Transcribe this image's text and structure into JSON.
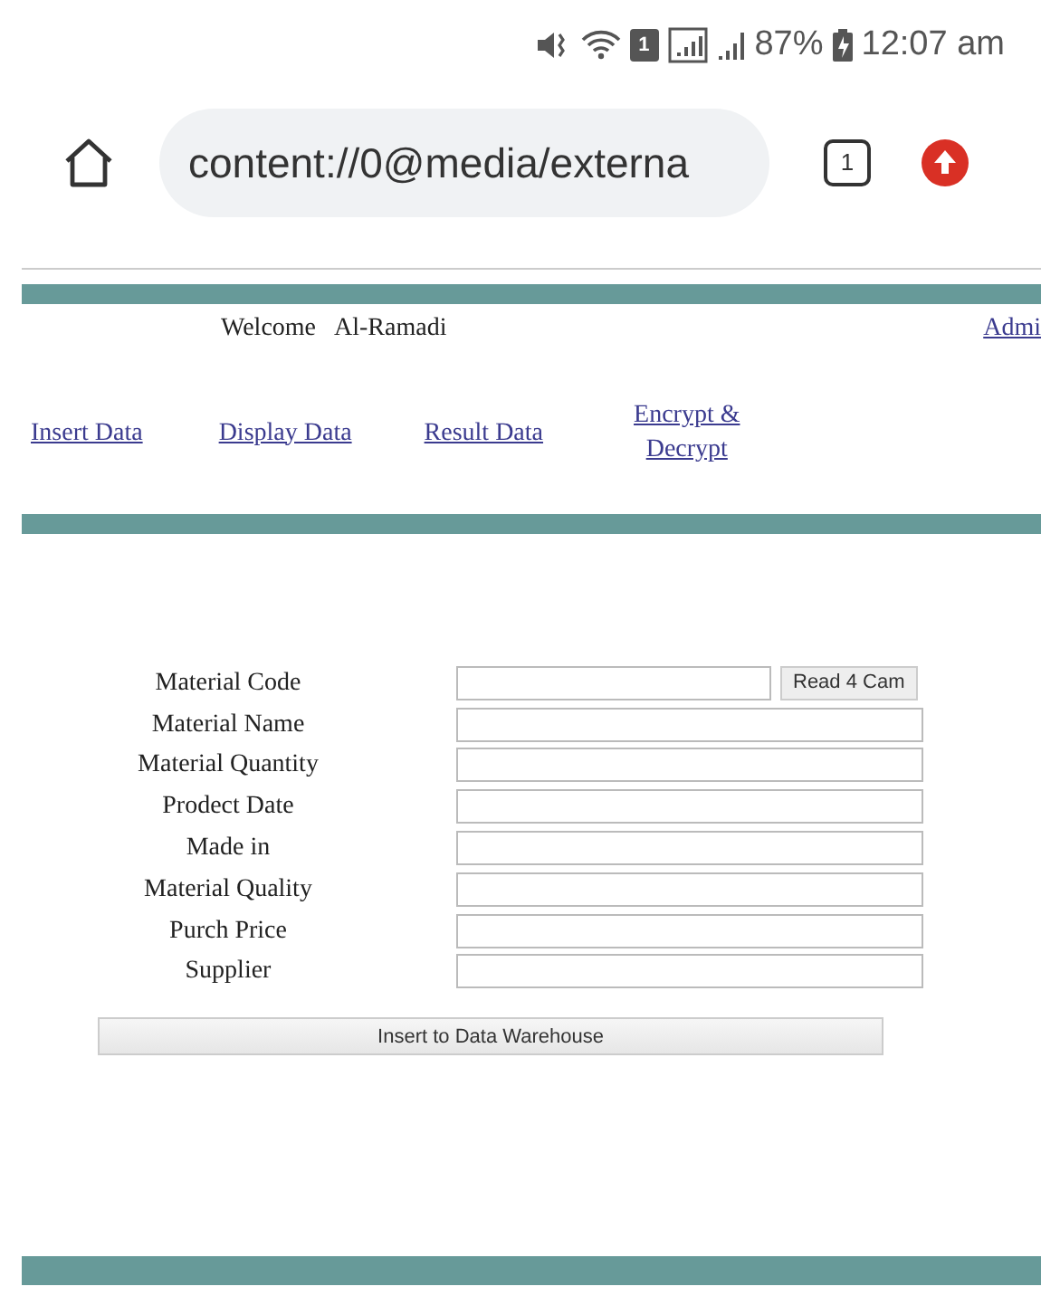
{
  "status_bar": {
    "sim_label": "1",
    "battery": "87%",
    "time": "12:07 am"
  },
  "browser": {
    "url": "content://0@media/externa",
    "tab_count": "1"
  },
  "header": {
    "welcome": "Welcome",
    "user": "Al-Ramadi",
    "admin_link": "Admi"
  },
  "nav": [
    {
      "label": "Insert Data"
    },
    {
      "label": "Display Data"
    },
    {
      "label": "Result Data"
    },
    {
      "label": "Encrypt &\nDecrypt"
    }
  ],
  "form": {
    "fields": [
      {
        "label": "Material Code",
        "button": "Read 4 Cam"
      },
      {
        "label": "Material Name"
      },
      {
        "label": "Material Quantity"
      },
      {
        "label": "Prodect Date"
      },
      {
        "label": "Made in"
      },
      {
        "label": "Material Quality"
      },
      {
        "label": "Purch Price"
      },
      {
        "label": "Supplier"
      }
    ],
    "submit": "Insert to Data Warehouse"
  }
}
